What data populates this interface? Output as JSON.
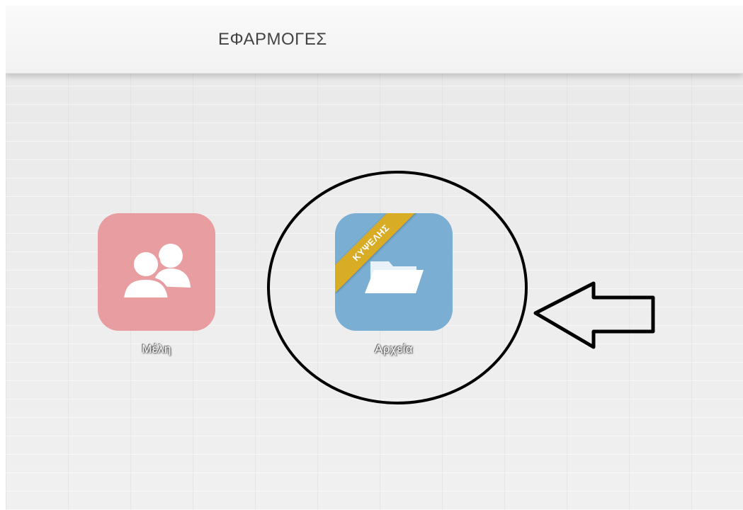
{
  "header": {
    "title": "ΕΦΑΡΜΟΓΕΣ"
  },
  "apps": [
    {
      "label": "Μέλη",
      "icon": "users-icon",
      "color": "#e89da0"
    },
    {
      "label": "Αρχεία",
      "icon": "folder-icon",
      "color": "#7aaed3",
      "ribbon": "ΚΥΨΕΛΗΣ",
      "ribbon_color": "#d8ac24"
    }
  ],
  "annotations": {
    "circle": "circle-highlight",
    "arrow": "arrow-pointer"
  }
}
